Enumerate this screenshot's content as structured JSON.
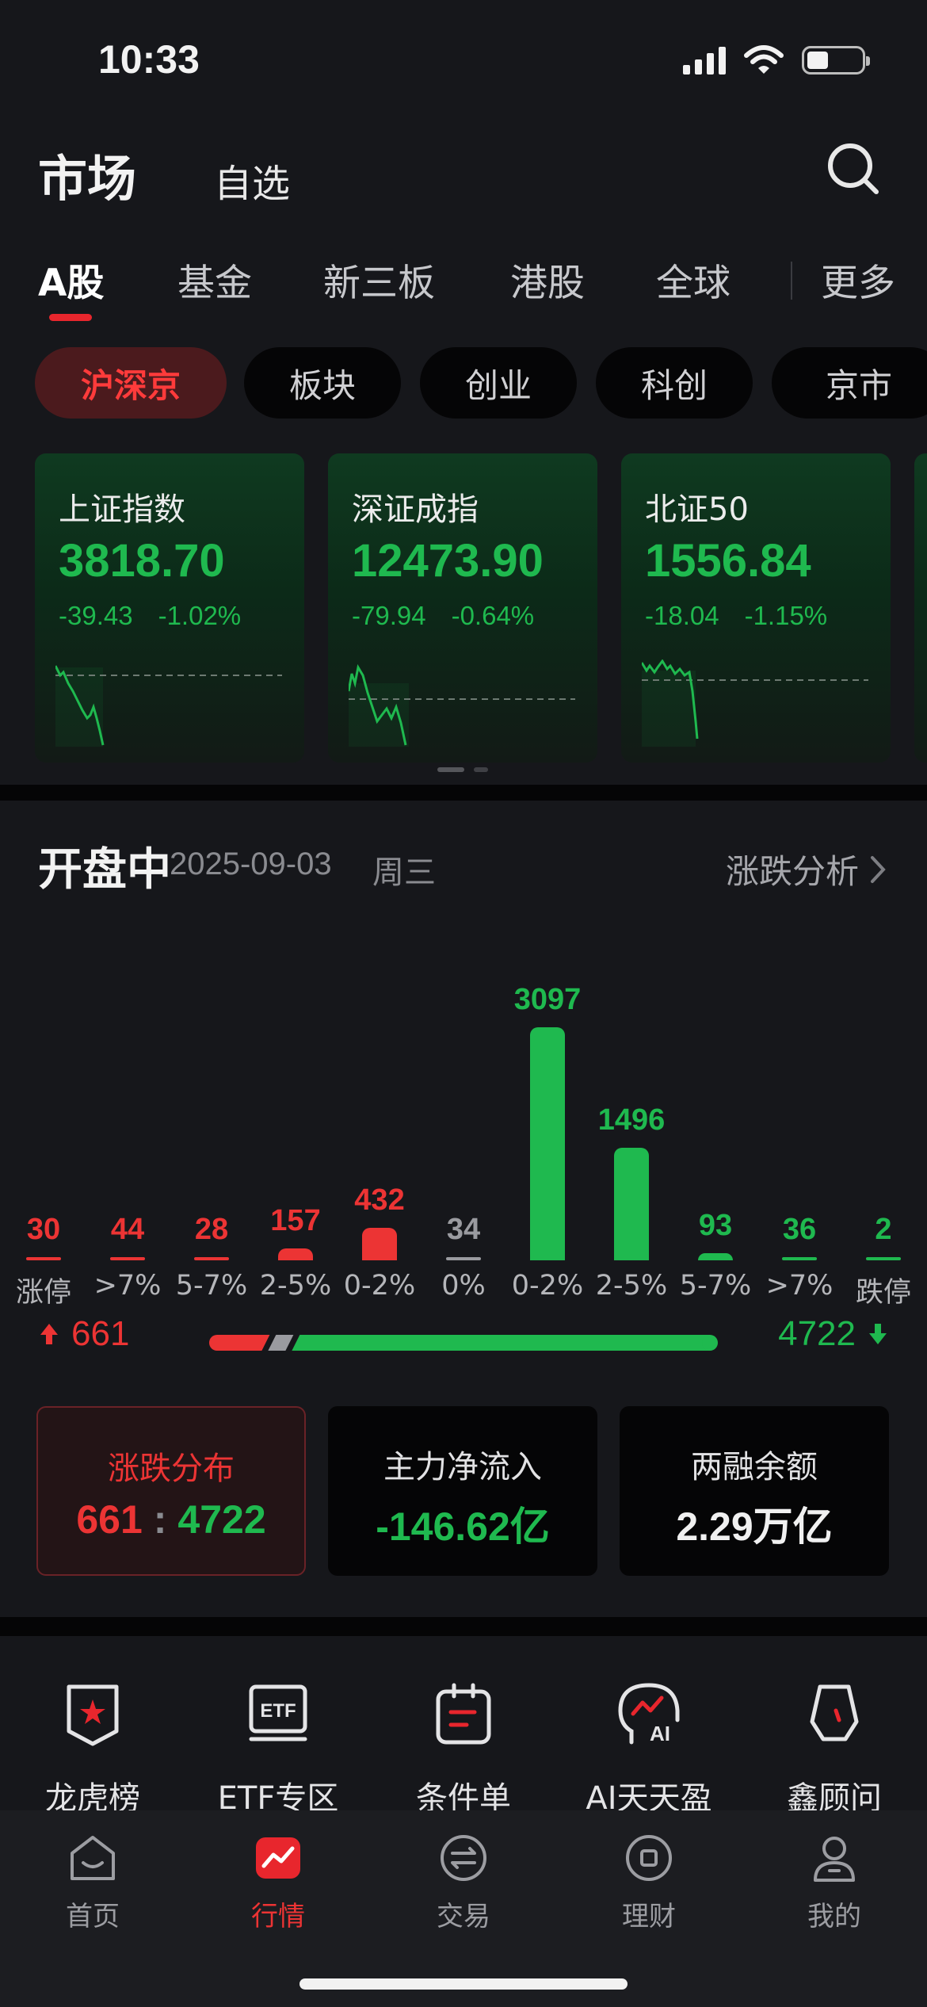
{
  "status": {
    "time": "10:33"
  },
  "header": {
    "title": "市场",
    "favorites": "自选"
  },
  "market_tabs": [
    "A股",
    "基金",
    "新三板",
    "港股",
    "全球",
    "更多"
  ],
  "sub_tabs": [
    "沪深京",
    "板块",
    "创业",
    "科创",
    "京市"
  ],
  "index_cards": [
    {
      "name": "上证指数",
      "value": "3818.70",
      "change": "-39.43",
      "pct": "-1.02%"
    },
    {
      "name": "深证成指",
      "value": "12473.90",
      "change": "-79.94",
      "pct": "-0.64%"
    },
    {
      "name": "北证50",
      "value": "1556.84",
      "change": "-18.04",
      "pct": "-1.15%"
    }
  ],
  "session": {
    "status": "开盘中",
    "date": "2025-09-03",
    "weekday": "周三",
    "analysis_link": "涨跌分析"
  },
  "chart_data": {
    "type": "bar",
    "categories": [
      "涨停",
      ">7%",
      "5-7%",
      "2-5%",
      "0-2%",
      "0%",
      "0-2%",
      "2-5%",
      "5-7%",
      ">7%",
      "跌停"
    ],
    "values": [
      30,
      44,
      28,
      157,
      432,
      34,
      3097,
      1496,
      93,
      36,
      2
    ],
    "colors": [
      "#ec3434",
      "#ec3434",
      "#ec3434",
      "#ec3434",
      "#ec3434",
      "#9a9ba0",
      "#1fb94f",
      "#1fb94f",
      "#1fb94f",
      "#1fb94f",
      "#1fb94f"
    ]
  },
  "summary": {
    "up_total": "661",
    "down_total": "4722",
    "flat_total": 34
  },
  "stats": [
    {
      "label": "涨跌分布",
      "up": "661",
      "sep": ":",
      "down": "4722"
    },
    {
      "label": "主力净流入",
      "value": "-146.62亿"
    },
    {
      "label": "两融余额",
      "value": "2.29万亿"
    }
  ],
  "tools": [
    {
      "label": "龙虎榜",
      "icon": "dragon-tiger-icon"
    },
    {
      "label": "ETF专区",
      "icon": "etf-icon"
    },
    {
      "label": "条件单",
      "icon": "condition-order-icon"
    },
    {
      "label": "AI天天盈",
      "icon": "ai-icon"
    },
    {
      "label": "鑫顾问",
      "icon": "advisor-icon"
    }
  ],
  "tabbar": [
    {
      "label": "首页",
      "icon": "home-icon"
    },
    {
      "label": "行情",
      "icon": "market-icon"
    },
    {
      "label": "交易",
      "icon": "trade-icon"
    },
    {
      "label": "理财",
      "icon": "wealth-icon"
    },
    {
      "label": "我的",
      "icon": "profile-icon"
    }
  ],
  "colors": {
    "up": "#ec3434",
    "down": "#1fb94f",
    "flat": "#9a9ba0",
    "accent": "#e8262d"
  }
}
